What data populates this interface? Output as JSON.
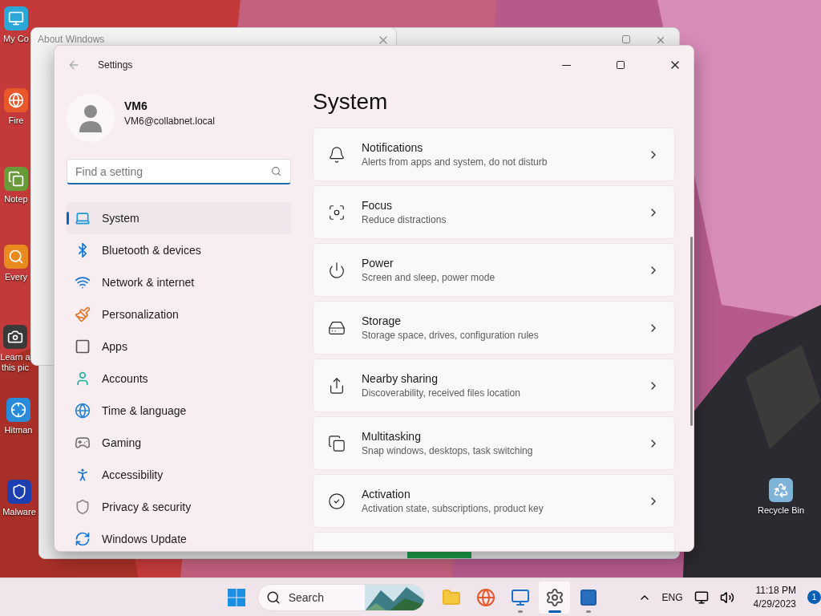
{
  "desktop_icons": [
    {
      "label": "My Co"
    },
    {
      "label": "Fire"
    },
    {
      "label": "Notep"
    },
    {
      "label": "Every"
    },
    {
      "label": "Learn a\nthis pic"
    },
    {
      "label": "Hitman"
    },
    {
      "label": "Malware"
    },
    {
      "label": "Recycle Bin"
    }
  ],
  "about_window": {
    "title": "About Windows"
  },
  "settings": {
    "title": "Settings",
    "user": {
      "name": "VM6",
      "email": "VM6@collabnet.local"
    },
    "search": {
      "placeholder": "Find a setting"
    },
    "nav": [
      {
        "label": "System",
        "selected": true
      },
      {
        "label": "Bluetooth & devices",
        "selected": false
      },
      {
        "label": "Network & internet",
        "selected": false
      },
      {
        "label": "Personalization",
        "selected": false
      },
      {
        "label": "Apps",
        "selected": false
      },
      {
        "label": "Accounts",
        "selected": false
      },
      {
        "label": "Time & language",
        "selected": false
      },
      {
        "label": "Gaming",
        "selected": false
      },
      {
        "label": "Accessibility",
        "selected": false
      },
      {
        "label": "Privacy & security",
        "selected": false
      },
      {
        "label": "Windows Update",
        "selected": false
      }
    ],
    "page_title": "System",
    "items": [
      {
        "title": "Notifications",
        "subtitle": "Alerts from apps and system, do not disturb"
      },
      {
        "title": "Focus",
        "subtitle": "Reduce distractions"
      },
      {
        "title": "Power",
        "subtitle": "Screen and sleep, power mode"
      },
      {
        "title": "Storage",
        "subtitle": "Storage space, drives, configuration rules"
      },
      {
        "title": "Nearby sharing",
        "subtitle": "Discoverability, received files location"
      },
      {
        "title": "Multitasking",
        "subtitle": "Snap windows, desktops, task switching"
      },
      {
        "title": "Activation",
        "subtitle": "Activation state, subscriptions, product key"
      }
    ]
  },
  "taskbar": {
    "search": "Search",
    "apps": [
      {
        "running": false,
        "selected": false
      },
      {
        "running": false,
        "selected": false
      },
      {
        "running": true,
        "selected": false
      },
      {
        "running": true,
        "selected": true
      },
      {
        "running": true,
        "selected": false
      }
    ],
    "language": "ENG",
    "time": "11:18 PM",
    "date": "4/29/2023",
    "notifications": "1"
  }
}
